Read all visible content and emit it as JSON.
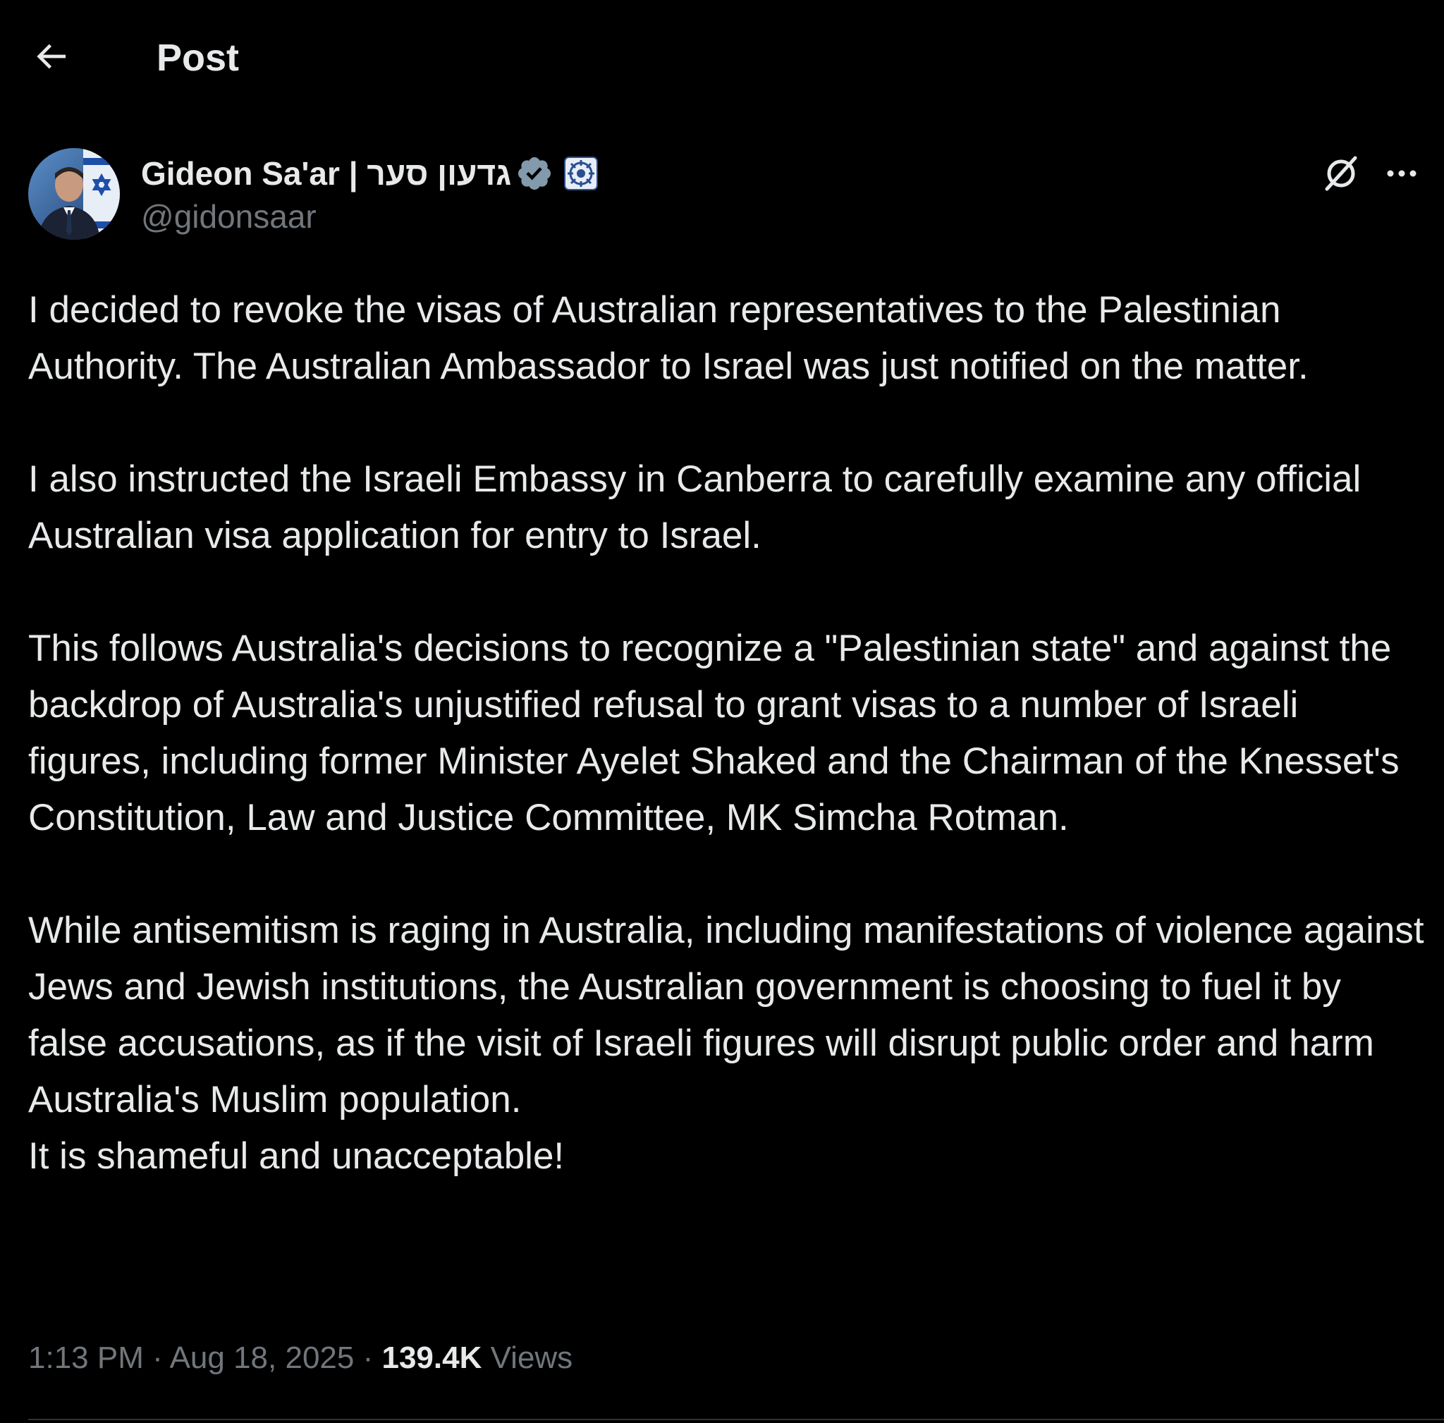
{
  "header": {
    "back_icon": "arrow-left-icon",
    "title": "Post"
  },
  "author": {
    "display_name": "Gideon Sa'ar | גדעון סער",
    "handle": "@gidonsaar",
    "verified_badge_icon": "verified-badge-icon",
    "affiliate_badge_icon": "government-affiliate-badge-icon",
    "verified_color": "#829aab"
  },
  "actions": {
    "grok_icon": "grok-icon",
    "more_icon": "more-horizontal-icon"
  },
  "post": {
    "paragraphs": [
      "I decided to revoke the visas of Australian representatives to the Palestinian Authority. The Australian Ambassador to Israel was just notified on the matter.",
      "I also instructed the Israeli Embassy in Canberra to carefully examine any official Australian visa application for entry to Israel.",
      "This follows Australia's decisions to recognize a \"Palestinian state\" and against the backdrop of Australia's unjustified refusal to grant visas to a number of Israeli figures, including former Minister Ayelet Shaked and the Chairman of the Knesset's Constitution, Law and Justice Committee, MK Simcha Rotman.",
      "While antisemitism is raging in Australia, including manifestations of violence against Jews and Jewish institutions, the Australian government is choosing to fuel it by false accusations, as if the visit of Israeli figures will disrupt public order and harm Australia's Muslim population.",
      "It is shameful and unacceptable!"
    ]
  },
  "meta": {
    "time": "1:13 PM",
    "separator": "·",
    "date": "Aug 18, 2025",
    "views_count": "139.4K",
    "views_label": "Views"
  },
  "colors": {
    "background": "#000000",
    "text_primary": "#e7e9ea",
    "text_secondary": "#71767b",
    "divider": "#2f3336"
  }
}
